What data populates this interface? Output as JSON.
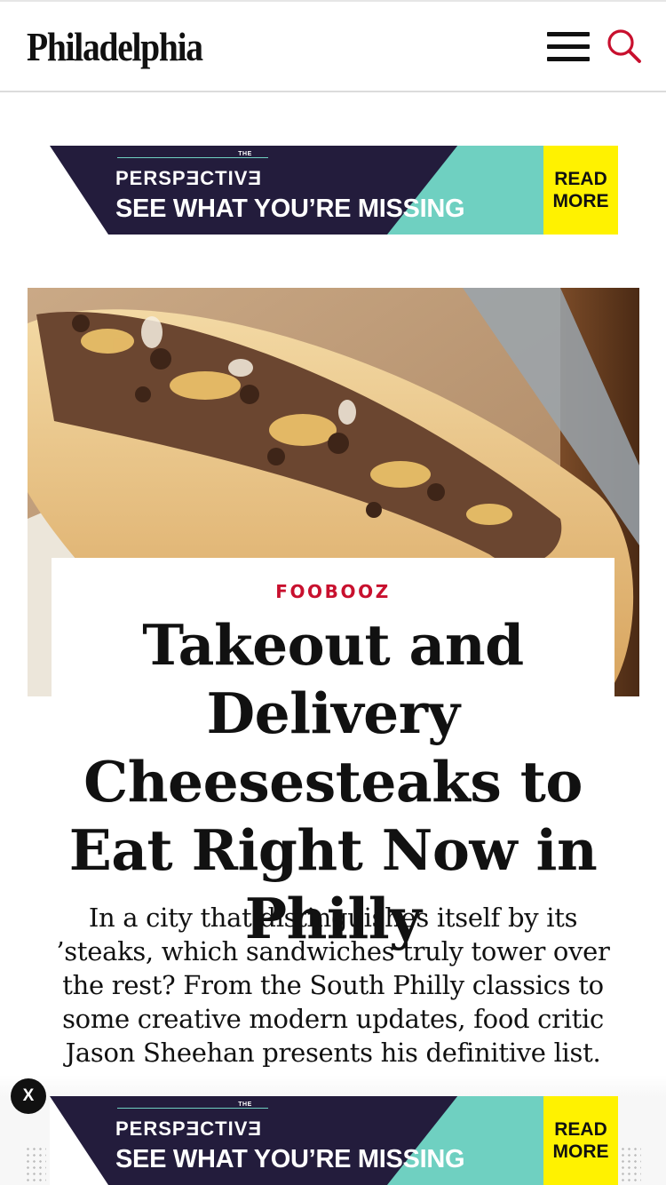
{
  "header": {
    "logo": "Philadelphia",
    "menu_icon": "hamburger-menu-icon",
    "search_icon": "search-icon"
  },
  "ad": {
    "brand_small": "THE",
    "title": "PERSPECTIVE",
    "title_display": "PERSPƎCTIVƎ",
    "tagline": "SEE WHAT YOU’RE MISSING",
    "cta_line1": "READ",
    "cta_line2": "MORE",
    "colors": {
      "background": "#231c3c",
      "accent": "#6fd0c1",
      "cta": "#fff200"
    }
  },
  "article": {
    "category": "FOOBOOZ",
    "headline": "Takeout and Delivery Cheesesteaks to Eat Right Now in Philly",
    "dek": "In a city that distinguishes itself by its ’steaks, which sandwiches truly tower over the rest? From the South Philly classics to some creative modern updates, food critic Jason Sheehan presents his definitive list.",
    "category_color": "#c8102e"
  },
  "close_button": {
    "label": "X"
  }
}
